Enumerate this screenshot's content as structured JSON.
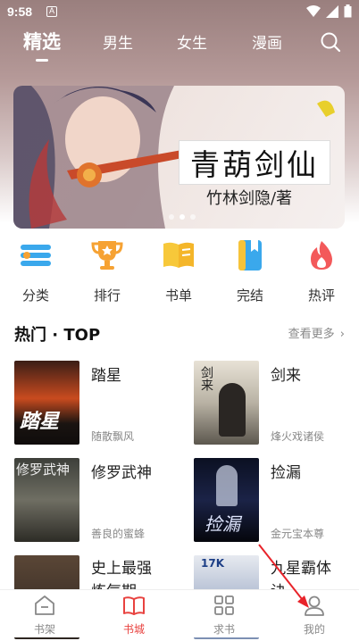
{
  "status": {
    "time": "9:58",
    "sim": "A"
  },
  "tabs": [
    {
      "label": "精选",
      "active": true
    },
    {
      "label": "男生"
    },
    {
      "label": "女生"
    },
    {
      "label": "漫画"
    }
  ],
  "banner": {
    "title": "青葫剑仙",
    "author": "竹林剑隐/著",
    "slide_index": 1,
    "slide_count": 3
  },
  "categories": [
    {
      "label": "分类",
      "icon": "category-list-icon"
    },
    {
      "label": "排行",
      "icon": "trophy-icon"
    },
    {
      "label": "书单",
      "icon": "open-book-icon"
    },
    {
      "label": "完结",
      "icon": "bookmark-book-icon"
    },
    {
      "label": "热评",
      "icon": "fire-icon"
    }
  ],
  "section": {
    "title": "热门 · TOP",
    "more": "查看更多"
  },
  "books": [
    {
      "title": "踏星",
      "author": "随散飘风",
      "cover_text": "踏星"
    },
    {
      "title": "剑来",
      "author": "烽火戏诸侯",
      "cover_text": "剑来"
    },
    {
      "title": "修罗武神",
      "author": "善良的蜜蜂",
      "cover_text": "修罗武神"
    },
    {
      "title": "捡漏",
      "author": "金元宝本尊",
      "cover_text": "捡漏"
    },
    {
      "title": "史上最强炼气期",
      "author": "",
      "cover_text": ""
    },
    {
      "title": "九星霸体诀",
      "author": "",
      "cover_text": "17K"
    }
  ],
  "nav": [
    {
      "label": "书架",
      "icon": "bookshelf-icon"
    },
    {
      "label": "书城",
      "icon": "bookstore-icon",
      "active": true
    },
    {
      "label": "求书",
      "icon": "grid-icon"
    },
    {
      "label": "我的",
      "icon": "profile-icon"
    }
  ],
  "colors": {
    "accent": "#e8423f",
    "header": "#9a7f7e"
  }
}
